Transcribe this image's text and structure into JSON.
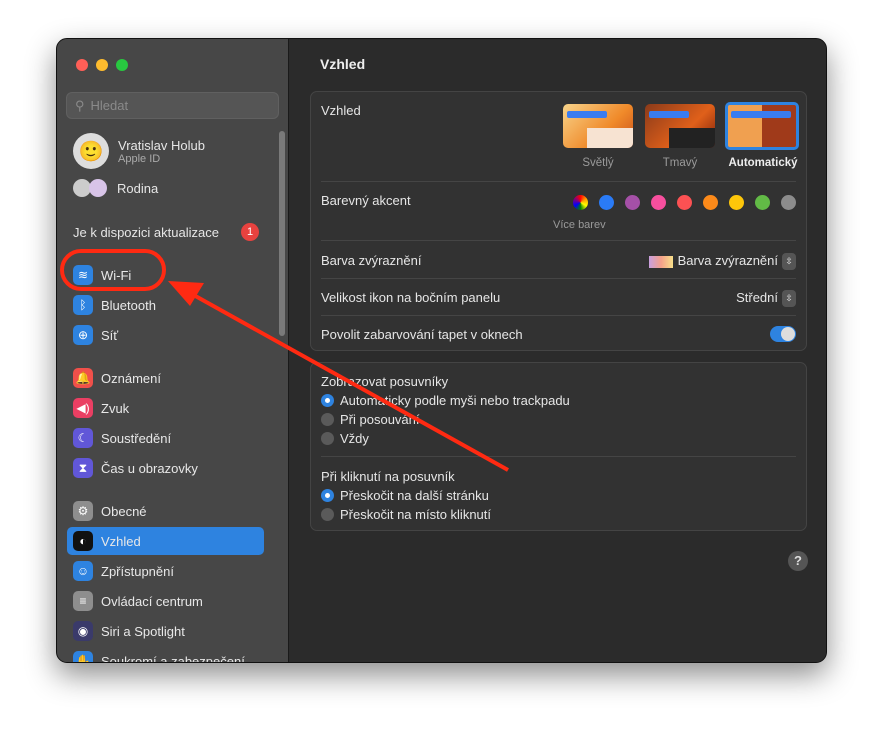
{
  "window": {
    "traffic_lights": [
      "#ff5f57",
      "#febc2e",
      "#28c840"
    ]
  },
  "sidebar": {
    "search_placeholder": "Hledat",
    "user": {
      "name": "Vratislav Holub",
      "subtitle": "Apple ID"
    },
    "family": "Rodina",
    "update": {
      "label": "Je k dispozici aktualizace",
      "badge": "1"
    },
    "items": [
      {
        "label": "Wi-Fi",
        "icon": "wifi-icon",
        "color": "#2e83e0"
      },
      {
        "label": "Bluetooth",
        "icon": "bluetooth-icon",
        "color": "#2e83e0"
      },
      {
        "label": "Síť",
        "icon": "globe-icon",
        "color": "#2e83e0"
      },
      {
        "label": "Oznámení",
        "icon": "bell-icon",
        "color": "#f0504a"
      },
      {
        "label": "Zvuk",
        "icon": "speaker-icon",
        "color": "#ea3f63"
      },
      {
        "label": "Soustředění",
        "icon": "moon-icon",
        "color": "#6157d8"
      },
      {
        "label": "Čas u obrazovky",
        "icon": "hourglass-icon",
        "color": "#6157d8"
      },
      {
        "label": "Obecné",
        "icon": "gear-icon",
        "color": "#8e8e8e"
      },
      {
        "label": "Vzhled",
        "icon": "appearance-icon",
        "color": "#111111"
      },
      {
        "label": "Zpřístupnění",
        "icon": "accessibility-icon",
        "color": "#2e83e0"
      },
      {
        "label": "Ovládací centrum",
        "icon": "control-center-icon",
        "color": "#8e8e8e"
      },
      {
        "label": "Siri a Spotlight",
        "icon": "siri-icon",
        "color": "#3a3a6a"
      },
      {
        "label": "Soukromí a zabezpečení",
        "icon": "hand-icon",
        "color": "#2e83e0"
      }
    ],
    "selected": "Vzhled"
  },
  "main": {
    "title": "Vzhled",
    "appearance": {
      "label": "Vzhled",
      "options": [
        "Světlý",
        "Tmavý",
        "Automatický"
      ],
      "selected": "Automatický"
    },
    "accent": {
      "label": "Barevný akcent",
      "more": "Více barev",
      "colors": [
        "#2a7bf6",
        "#a550a7",
        "#f74f9e",
        "#fc5153",
        "#fc8a1a",
        "#fdc60a",
        "#62ba46",
        "#8c8c8c"
      ]
    },
    "highlight": {
      "label": "Barva zvýraznění",
      "value": "Barva zvýraznění"
    },
    "icon_size": {
      "label": "Velikost ikon na bočním panelu",
      "value": "Střední"
    },
    "wallpaper_tint": {
      "label": "Povolit zabarvování tapet v oknech",
      "on": true
    },
    "scrollbars": {
      "label": "Zobrazovat posuvníky",
      "options": [
        "Automaticky podle myši nebo trackpadu",
        "Při posouvání",
        "Vždy"
      ],
      "selected": 0
    },
    "click": {
      "label": "Při kliknutí na posuvník",
      "options": [
        "Přeskočit na další stránku",
        "Přeskočit na místo kliknutí"
      ],
      "selected": 0
    },
    "help": "?"
  },
  "annotation": {
    "color": "#ff2a12"
  }
}
